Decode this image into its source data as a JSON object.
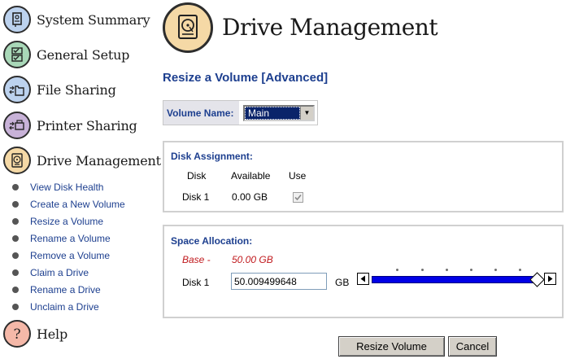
{
  "sidebar": {
    "main_items": [
      {
        "label": "System Summary",
        "icon": "system-summary-icon",
        "color": "#bcd2ee"
      },
      {
        "label": "General Setup",
        "icon": "checklist-icon",
        "color": "#a9d8b8"
      },
      {
        "label": "File Sharing",
        "icon": "folder-share-icon",
        "color": "#bcd2ee"
      },
      {
        "label": "Printer Sharing",
        "icon": "printer-share-icon",
        "color": "#c8b2d8"
      },
      {
        "label": "Drive Management",
        "icon": "hard-drive-icon",
        "color": "#f5d9a6"
      }
    ],
    "sub_items": [
      "View Disk Health",
      "Create a New Volume",
      "Resize a Volume",
      "Rename a Volume",
      "Remove a Volume",
      "Claim a Drive",
      "Rename a Drive",
      "Unclaim a Drive"
    ],
    "help": {
      "label": "Help",
      "icon": "question-mark-icon",
      "color": "#f5b8a8"
    }
  },
  "header": {
    "title": "Drive Management",
    "icon": "hard-drive-icon"
  },
  "page": {
    "section_title": "Resize a Volume [Advanced]"
  },
  "volume": {
    "label": "Volume Name:",
    "selected": "Main"
  },
  "disk_assignment": {
    "title": "Disk Assignment:",
    "columns": [
      "Disk",
      "Available",
      "Use"
    ],
    "rows": [
      {
        "disk": "Disk 1",
        "available": "0.00 GB",
        "use_checked": true
      }
    ]
  },
  "space_allocation": {
    "title": "Space Allocation:",
    "base_label": "Base -",
    "base_value": "50.00 GB",
    "disk_label": "Disk 1",
    "input_value": "50.009499648",
    "unit": "GB",
    "slider_fraction": 1.0
  },
  "buttons": {
    "resize": "Resize Volume",
    "cancel": "Cancel"
  },
  "colors": {
    "link": "#1d3f8f",
    "base_red": "#c0191d",
    "slider_fill": "#0000e6"
  }
}
